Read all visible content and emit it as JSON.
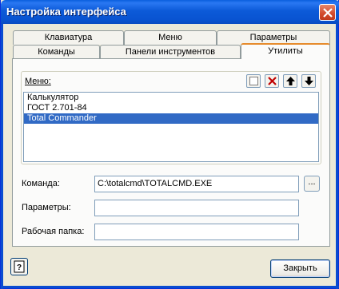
{
  "window": {
    "title": "Настройка интерфейса"
  },
  "tabs": {
    "back_row": [
      "Клавиатура",
      "Меню",
      "Параметры"
    ],
    "front_row": [
      "Команды",
      "Панели инструментов",
      "Утилиты"
    ],
    "active": "Утилиты"
  },
  "menu_group": {
    "label": "Меню:",
    "toolbar_icons": [
      "new-item-icon",
      "delete-icon",
      "move-up-icon",
      "move-down-icon"
    ],
    "items": [
      "Калькулятор",
      "ГОСТ 2.701-84",
      "Total Commander"
    ],
    "selected_index": 2
  },
  "fields": {
    "command_label": "Команда:",
    "command_value": "C:\\totalcmd\\TOTALCMD.EXE",
    "browse_label": "...",
    "params_label": "Параметры:",
    "params_value": "",
    "workdir_label": "Рабочая папка:",
    "workdir_value": ""
  },
  "buttons": {
    "close_label": "Закрыть"
  },
  "colors": {
    "title_bar": "#0a5fdd",
    "selection": "#316ac5",
    "active_tab_accent": "#e68b2c",
    "close_icon": "#d2492b"
  }
}
